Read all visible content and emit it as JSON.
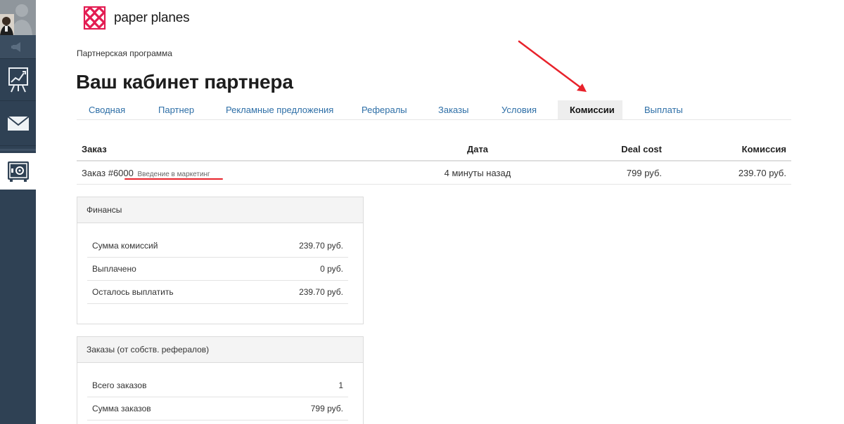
{
  "brand": {
    "name": "paper planes",
    "accent": "#e31c52"
  },
  "sidebar": {
    "items": [
      {
        "icon": "user-avatar-icon"
      },
      {
        "icon": "volume-icon"
      },
      {
        "icon": "chart-board-icon"
      },
      {
        "icon": "mail-icon"
      },
      {
        "icon": "safe-icon",
        "active": true
      }
    ]
  },
  "breadcrumb": "Партнерская программа",
  "title": "Ваш кабинет партнера",
  "tabs": [
    {
      "label": "Сводная"
    },
    {
      "label": "Партнер"
    },
    {
      "label": "Рекламные предложения"
    },
    {
      "label": "Рефералы"
    },
    {
      "label": "Заказы"
    },
    {
      "label": "Условия"
    },
    {
      "label": "Комиссии",
      "active": true
    },
    {
      "label": "Выплаты"
    }
  ],
  "orders": {
    "headers": {
      "order": "Заказ",
      "date": "Дата",
      "deal": "Deal cost",
      "commission": "Комиссия"
    },
    "rows": [
      {
        "order": "Заказ #6000",
        "product": "Введение в маркетинг",
        "date": "4 минуты назад",
        "deal": "799 руб.",
        "commission": "239.70 руб."
      }
    ]
  },
  "finance": {
    "title": "Финансы",
    "rows": [
      {
        "label": "Сумма комиссий",
        "value": "239.70 руб."
      },
      {
        "label": "Выплачено",
        "value": "0 руб."
      },
      {
        "label": "Осталось выплатить",
        "value": "239.70 руб."
      }
    ]
  },
  "orders_summary": {
    "title": "Заказы (от собств. рефералов)",
    "rows": [
      {
        "label": "Всего заказов",
        "value": "1"
      },
      {
        "label": "Сумма заказов",
        "value": "799 руб."
      }
    ]
  },
  "annotation_color": "#e8222b"
}
